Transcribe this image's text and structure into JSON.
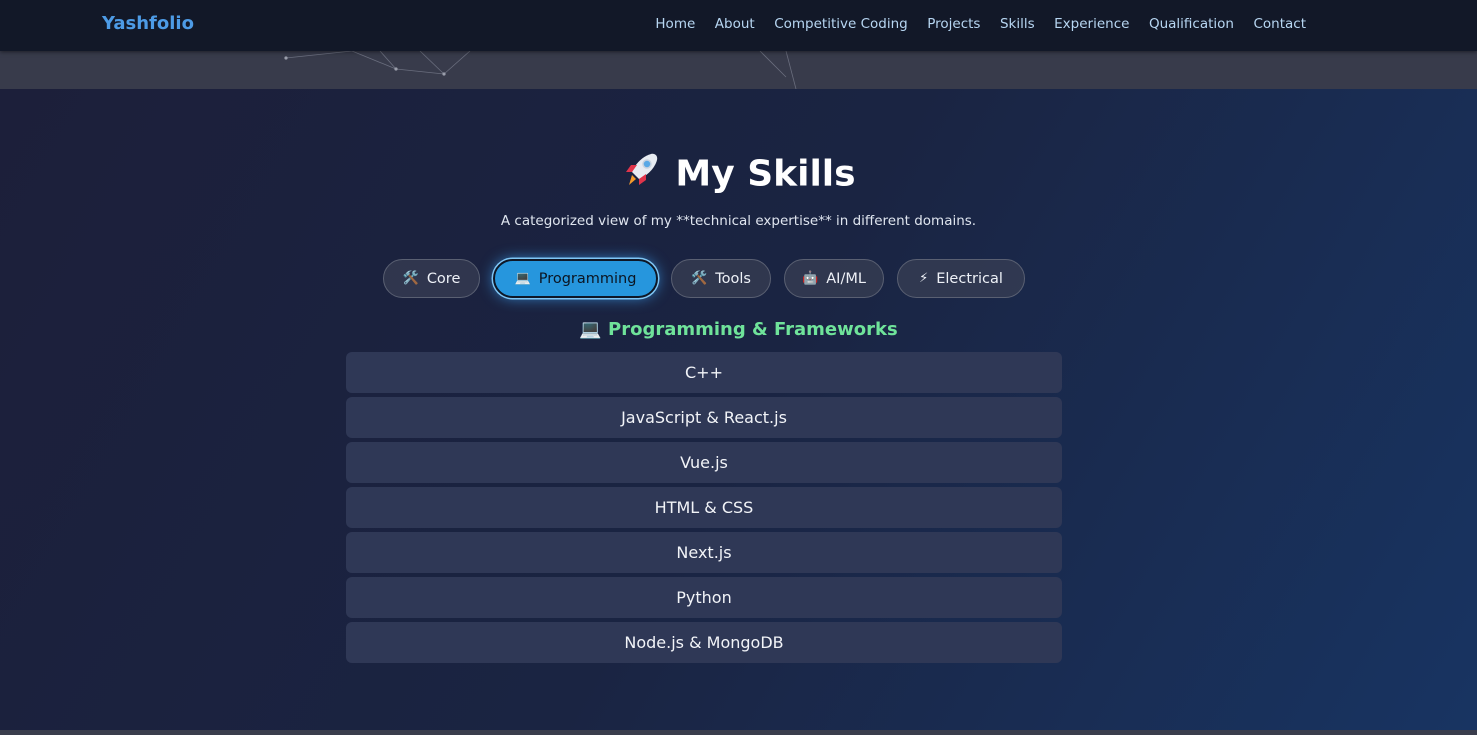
{
  "navbar": {
    "brand": "Yashfolio",
    "links": [
      "Home",
      "About",
      "Competitive Coding",
      "Projects",
      "Skills",
      "Experience",
      "Qualification",
      "Contact"
    ]
  },
  "hero": {
    "title": "My Skills",
    "subtitle": "A categorized view of my **technical expertise** in different domains."
  },
  "tabs": [
    {
      "icon": "🛠️",
      "icon_name": "tools-icon",
      "label": "Core",
      "active": false
    },
    {
      "icon": "💻",
      "icon_name": "laptop-icon",
      "label": "Programming",
      "active": true
    },
    {
      "icon": "🛠️",
      "icon_name": "tools-icon",
      "label": "Tools",
      "active": false
    },
    {
      "icon": "🤖",
      "icon_name": "robot-icon",
      "label": "AI/ML",
      "active": false
    },
    {
      "icon": "⚡",
      "icon_name": "lightning-icon",
      "label": "Electrical",
      "active": false
    }
  ],
  "section": {
    "icon": "💻",
    "heading": "Programming & Frameworks"
  },
  "skills": [
    "C++",
    "JavaScript & React.js",
    "Vue.js",
    "HTML & CSS",
    "Next.js",
    "Python",
    "Node.js & MongoDB"
  ],
  "colors": {
    "brand": "#4d9be6",
    "active_tab": "#2696dd",
    "section_heading": "#6fe39a",
    "skill_card": "#2f3856"
  }
}
